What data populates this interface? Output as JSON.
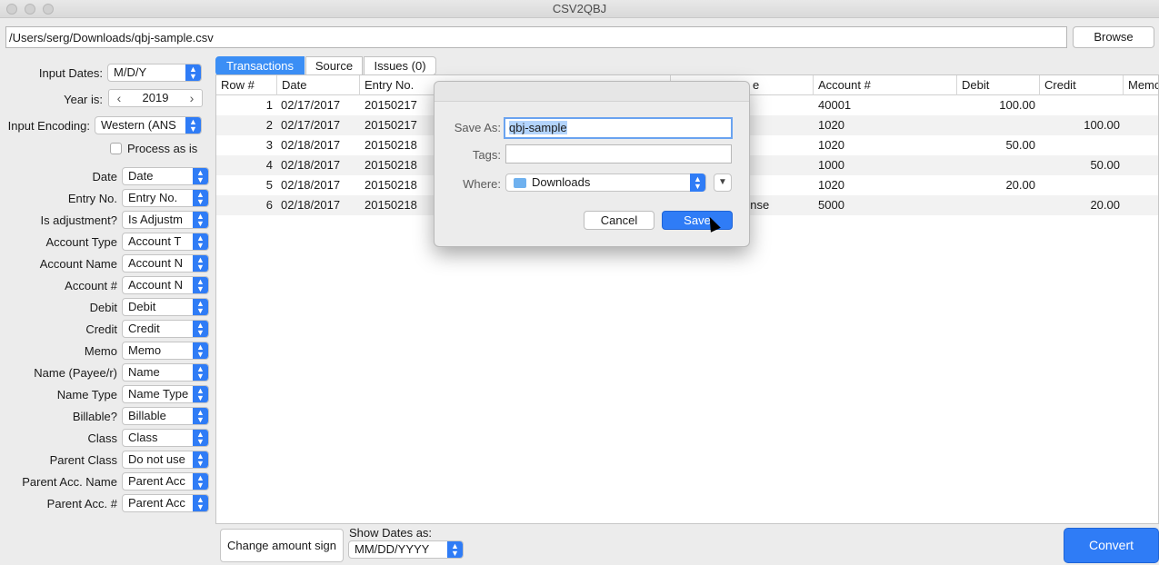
{
  "window": {
    "title": "CSV2QBJ"
  },
  "path": {
    "value": "/Users/serg/Downloads/qbj-sample.csv",
    "browse_label": "Browse"
  },
  "settings": {
    "input_dates_label": "Input Dates:",
    "input_dates_value": "M/D/Y",
    "year_label": "Year is:",
    "year_value": "2019",
    "input_encoding_label": "Input Encoding:",
    "input_encoding_value": "Western (ANS",
    "process_as_is_label": "Process as is"
  },
  "mappings": [
    {
      "label": "Date",
      "value": "Date"
    },
    {
      "label": "Entry No.",
      "value": "Entry No."
    },
    {
      "label": "Is adjustment?",
      "value": "Is Adjustm"
    },
    {
      "label": "Account Type",
      "value": "Account T"
    },
    {
      "label": "Account Name",
      "value": "Account N"
    },
    {
      "label": "Account #",
      "value": "Account N"
    },
    {
      "label": "Debit",
      "value": "Debit"
    },
    {
      "label": "Credit",
      "value": "Credit"
    },
    {
      "label": "Memo",
      "value": "Memo"
    },
    {
      "label": "Name (Payee/r)",
      "value": "Name"
    },
    {
      "label": "Name Type",
      "value": "Name Type"
    },
    {
      "label": "Billable?",
      "value": "Billable"
    },
    {
      "label": "Class",
      "value": "Class"
    },
    {
      "label": "Parent Class",
      "value": "Do not use"
    },
    {
      "label": "Parent Acc. Name",
      "value": "Parent Acc"
    },
    {
      "label": "Parent Acc. #",
      "value": "Parent Acc"
    }
  ],
  "tabs": [
    {
      "label": "Transactions",
      "active": true
    },
    {
      "label": "Source",
      "active": false
    },
    {
      "label": "Issues (0)",
      "active": false
    }
  ],
  "table": {
    "columns": [
      "Row #",
      "Date",
      "Entry No.",
      "",
      "",
      "",
      "Account #",
      "Debit",
      "Credit",
      "Memo"
    ],
    "rows": [
      {
        "row": "1",
        "date": "02/17/2017",
        "entry": "20150217",
        "name": "",
        "account": "40001",
        "debit": "100.00",
        "credit": ""
      },
      {
        "row": "2",
        "date": "02/17/2017",
        "entry": "20150217",
        "name": "",
        "account": "1020",
        "debit": "",
        "credit": "100.00"
      },
      {
        "row": "3",
        "date": "02/18/2017",
        "entry": "20150218",
        "name": "",
        "account": "1020",
        "debit": "50.00",
        "credit": ""
      },
      {
        "row": "4",
        "date": "02/18/2017",
        "entry": "20150218",
        "name": "",
        "account": "1000",
        "debit": "",
        "credit": "50.00"
      },
      {
        "row": "5",
        "date": "02/18/2017",
        "entry": "20150218",
        "name": "",
        "account": "1020",
        "debit": "20.00",
        "credit": ""
      },
      {
        "row": "6",
        "date": "02/18/2017",
        "entry": "20150218",
        "name": "ense",
        "account": "5000",
        "debit": "",
        "credit": "20.00"
      }
    ],
    "partial_header": "e"
  },
  "bottom": {
    "change_sign_label": "Change amount sign",
    "show_dates_label": "Show Dates as:",
    "show_dates_value": "MM/DD/YYYY",
    "convert_label": "Convert"
  },
  "save_dialog": {
    "save_as_label": "Save As:",
    "save_as_value": "qbj-sample",
    "tags_label": "Tags:",
    "tags_value": "",
    "where_label": "Where:",
    "where_value": "Downloads",
    "cancel_label": "Cancel",
    "save_label": "Save"
  },
  "colors": {
    "accent": "#2f7cf6",
    "tab_active": "#3b8ef5"
  }
}
